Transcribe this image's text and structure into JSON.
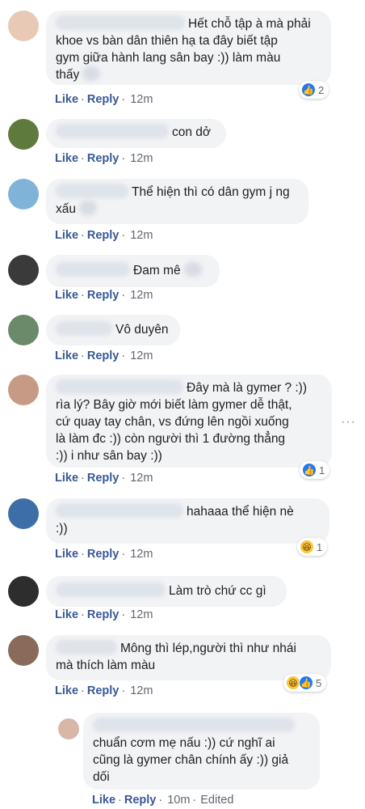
{
  "actions": {
    "like": "Like",
    "reply": "Reply",
    "sep": "·"
  },
  "comments": [
    {
      "text_lines": [
        "Hết chỗ tập à mà phải",
        "khoe vs bàn dân thiên hạ ta đây biết tập",
        "gym giữa hành lang sân bay :)) làm màu",
        "thấy"
      ],
      "time": "12m",
      "reactions": {
        "icons": [
          "like-icon"
        ],
        "count": "2"
      },
      "avatar_color": "#e8c9b5"
    },
    {
      "text_lines": [
        "con dở"
      ],
      "time": "12m",
      "avatar_color": "#5e7a3c"
    },
    {
      "text_lines": [
        "Thể hiện thì có dân gym j ng",
        "xấu"
      ],
      "time": "12m",
      "avatar_color": "#7fb3d8"
    },
    {
      "text_lines": [
        "Đam mê"
      ],
      "time": "12m",
      "avatar_color": "#3a3a3a"
    },
    {
      "text_lines": [
        "Vô duyên"
      ],
      "time": "12m",
      "avatar_color": "#6a8a6a"
    },
    {
      "text_lines": [
        "Đây mà là gymer ? :))",
        "rìa lý? Bây giờ mới biết làm gymer dễ thật,",
        "cứ quay tay chân, vs đứng lên ngồi xuống",
        "là làm đc :)) còn người thì 1 đường thẳng",
        ":)) i như sân bay :))"
      ],
      "time": "12m",
      "reactions": {
        "icons": [
          "like-icon"
        ],
        "count": "1"
      },
      "avatar_color": "#c79a86"
    },
    {
      "text_lines": [
        "hahaaa thể hiện nè",
        ":))"
      ],
      "time": "12m",
      "reactions": {
        "icons": [
          "haha-icon"
        ],
        "count": "1"
      },
      "avatar_color": "#3d6ea8"
    },
    {
      "text_lines": [
        "Làm trò chứ cc gì"
      ],
      "time": "12m",
      "avatar_color": "#2d2d2d"
    },
    {
      "text_lines": [
        "Mông thì lép,người thì như nhái",
        "mà thích làm màu"
      ],
      "time": "12m",
      "reactions": {
        "icons": [
          "haha-icon",
          "like-icon"
        ],
        "count": "5"
      },
      "avatar_color": "#8a6a5a"
    },
    {
      "text_lines": [
        "chuẩn cơm mẹ nấu :)) cứ nghĩ ai",
        "cũng là gymer chân chính ấy :)) giả",
        "dối"
      ],
      "time": "10m",
      "edited": "Edited",
      "avatar_color": "#d8b6a8"
    }
  ],
  "more_icon": "more-dots-icon",
  "more_glyph": "···",
  "reaction_glyphs": {
    "like-icon": "👍",
    "haha-icon": "😆"
  }
}
